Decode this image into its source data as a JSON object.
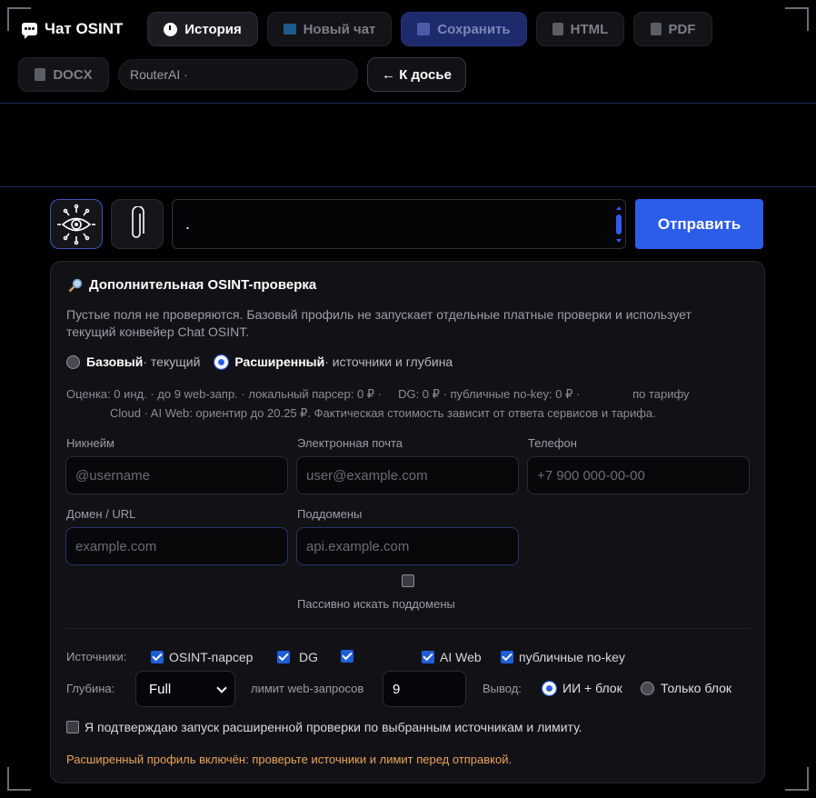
{
  "header": {
    "title": "Чат OSINT",
    "buttons": {
      "history": "История",
      "new_chat": "Новый чат",
      "save": "Сохранить",
      "html": "HTML",
      "pdf": "PDF",
      "docx": "DOCX",
      "back": "← К досье"
    },
    "model_selector": "RouterAI ·"
  },
  "composer": {
    "message_value": ".",
    "send_label": "Отправить"
  },
  "panel": {
    "title": "Дополнительная OSINT-проверка",
    "description": "Пустые поля не проверяются. Базовый профиль не запускает отдельные платные проверки и использует текущий конвейер Chat OSINT.",
    "mode_basic_bold": "Базовый",
    "mode_basic_rest": " · текущий",
    "mode_ext_bold": "Расширенный",
    "mode_ext_rest": " · источники и глубина",
    "estimate_line1": "Оценка: 0 инд. · до 9 web-запр. · локальный парсер: 0 ₽ ·     DG: 0 ₽ · публичные no-key: 0 ₽ ·                по тарифу",
    "estimate_line2": "Cloud · AI Web: ориентир до 20.25 ₽. Фактическая стоимость зависит от ответа сервисов и тарифа.",
    "fields": {
      "nickname_label": "Никнейм",
      "nickname_placeholder": "@username",
      "email_label": "Электронная почта",
      "email_placeholder": "user@example.com",
      "phone_label": "Телефон",
      "phone_placeholder": "+7 900 000-00-00",
      "domain_label": "Домен / URL",
      "domain_placeholder": "example.com",
      "subdomains_label": "Поддомены",
      "subdomains_placeholder": "api.example.com",
      "passive_label": "Пассивно искать поддомены"
    },
    "sources": {
      "label": "Источники:",
      "osint_parser": "OSINT-парсер",
      "dg": "DG",
      "ai_web": "AI Web",
      "public_nokey": "публичные no-key"
    },
    "depth": {
      "label": "Глубина:",
      "value": "Full",
      "limit_label": "лимит web-запросов",
      "limit_value": "9",
      "output_label": "Вывод:",
      "output_ai": "ИИ + блок",
      "output_block": "Только блок"
    },
    "confirm_label": "Я подтверждаю запуск расширенной проверки по выбранным источникам и лимиту.",
    "warning": "Расширенный профиль включён: проверьте источники и лимит перед отправкой."
  }
}
